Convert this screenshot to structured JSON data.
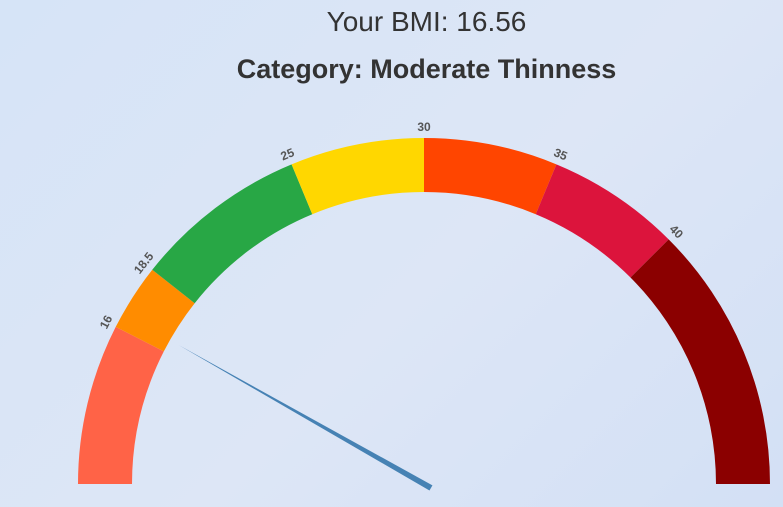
{
  "header": {
    "bmi_text": "Your BMI: 16.56",
    "category_text": "Category: Moderate Thinness"
  },
  "chart_data": {
    "type": "gauge",
    "value": 16.56,
    "range": [
      10,
      50
    ],
    "bands": [
      {
        "from": 10,
        "to": 16,
        "color": "#ff6347"
      },
      {
        "from": 16,
        "to": 18.5,
        "color": "#ff8c00"
      },
      {
        "from": 18.5,
        "to": 25,
        "color": "#28a745"
      },
      {
        "from": 25,
        "to": 30,
        "color": "#ffd700"
      },
      {
        "from": 30,
        "to": 35,
        "color": "#ff4500"
      },
      {
        "from": 35,
        "to": 40,
        "color": "#dc143c"
      },
      {
        "from": 40,
        "to": 50,
        "color": "#8b0000"
      }
    ],
    "tick_labels": [
      "16",
      "18.5",
      "25",
      "30",
      "35",
      "40"
    ],
    "needle_color": "#4682b4"
  }
}
